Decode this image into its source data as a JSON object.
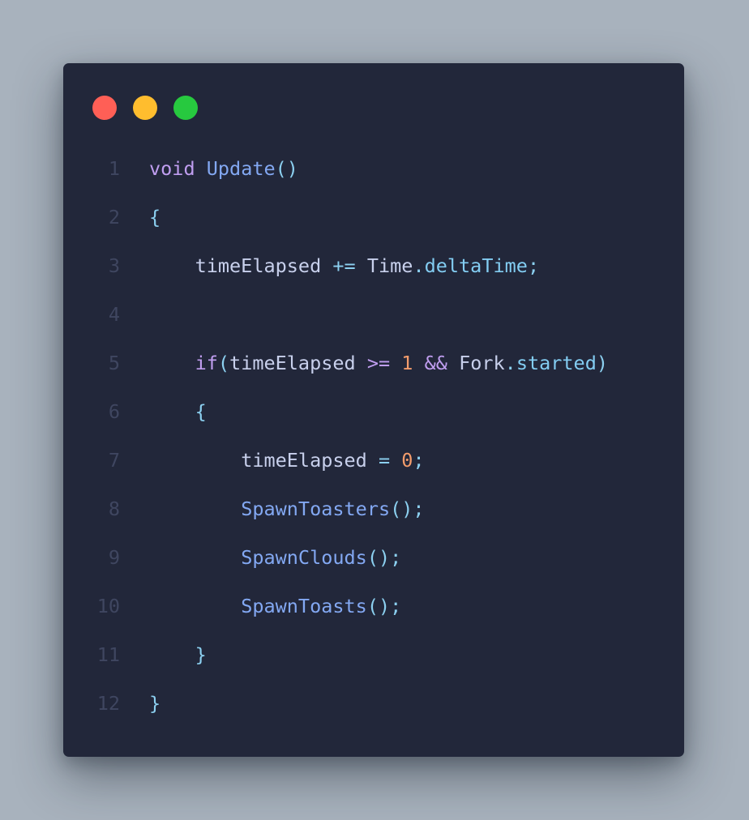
{
  "colors": {
    "background": "#a8b2bd",
    "window": "#22273a",
    "dot_red": "#ff5f57",
    "dot_yellow": "#febc2e",
    "dot_green": "#28c840"
  },
  "window_controls": [
    {
      "name": "close-dot",
      "color": "#ff5f56"
    },
    {
      "name": "minimize-dot",
      "color": "#ffbd2e"
    },
    {
      "name": "maximize-dot",
      "color": "#27c93f"
    }
  ],
  "code": {
    "lines": [
      {
        "number": "1",
        "indent": "",
        "tokens": [
          {
            "t": "void",
            "k": "keyword"
          },
          {
            "t": " ",
            "k": "ident"
          },
          {
            "t": "Update",
            "k": "func"
          },
          {
            "t": "()",
            "k": "punct"
          }
        ]
      },
      {
        "number": "2",
        "indent": "",
        "tokens": [
          {
            "t": "{",
            "k": "punct"
          }
        ]
      },
      {
        "number": "3",
        "indent": "    ",
        "tokens": [
          {
            "t": "timeElapsed",
            "k": "ident"
          },
          {
            "t": " ",
            "k": "ident"
          },
          {
            "t": "+=",
            "k": "op"
          },
          {
            "t": " ",
            "k": "ident"
          },
          {
            "t": "Time",
            "k": "ident"
          },
          {
            "t": ".",
            "k": "punct"
          },
          {
            "t": "deltaTime",
            "k": "prop"
          },
          {
            "t": ";",
            "k": "punct"
          }
        ]
      },
      {
        "number": "4",
        "indent": "",
        "tokens": []
      },
      {
        "number": "5",
        "indent": "    ",
        "tokens": [
          {
            "t": "if",
            "k": "keyword"
          },
          {
            "t": "(",
            "k": "punct"
          },
          {
            "t": "timeElapsed",
            "k": "ident"
          },
          {
            "t": " ",
            "k": "ident"
          },
          {
            "t": ">=",
            "k": "op2"
          },
          {
            "t": " ",
            "k": "ident"
          },
          {
            "t": "1",
            "k": "num"
          },
          {
            "t": " ",
            "k": "ident"
          },
          {
            "t": "&&",
            "k": "op2"
          },
          {
            "t": " ",
            "k": "ident"
          },
          {
            "t": "Fork",
            "k": "ident"
          },
          {
            "t": ".",
            "k": "punct"
          },
          {
            "t": "started",
            "k": "prop"
          },
          {
            "t": ")",
            "k": "punct"
          }
        ]
      },
      {
        "number": "6",
        "indent": "    ",
        "tokens": [
          {
            "t": "{",
            "k": "punct"
          }
        ]
      },
      {
        "number": "7",
        "indent": "        ",
        "tokens": [
          {
            "t": "timeElapsed",
            "k": "ident"
          },
          {
            "t": " ",
            "k": "ident"
          },
          {
            "t": "=",
            "k": "op"
          },
          {
            "t": " ",
            "k": "ident"
          },
          {
            "t": "0",
            "k": "num"
          },
          {
            "t": ";",
            "k": "punct"
          }
        ]
      },
      {
        "number": "8",
        "indent": "        ",
        "tokens": [
          {
            "t": "SpawnToasters",
            "k": "func"
          },
          {
            "t": "();",
            "k": "punct"
          }
        ]
      },
      {
        "number": "9",
        "indent": "        ",
        "tokens": [
          {
            "t": "SpawnClouds",
            "k": "func"
          },
          {
            "t": "();",
            "k": "punct"
          }
        ]
      },
      {
        "number": "10",
        "indent": "        ",
        "tokens": [
          {
            "t": "SpawnToasts",
            "k": "func"
          },
          {
            "t": "();",
            "k": "punct"
          }
        ]
      },
      {
        "number": "11",
        "indent": "    ",
        "tokens": [
          {
            "t": "}",
            "k": "punct"
          }
        ]
      },
      {
        "number": "12",
        "indent": "",
        "tokens": [
          {
            "t": "}",
            "k": "punct"
          }
        ]
      }
    ]
  }
}
